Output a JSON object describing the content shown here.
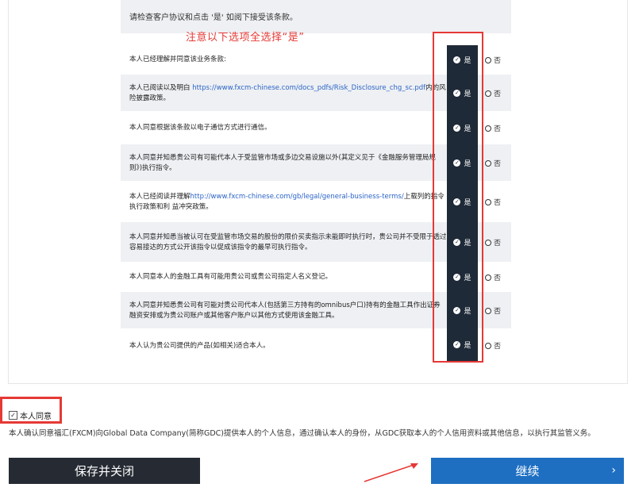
{
  "intro": {
    "text": "请检查客户协议和点击 '是' 如阅下接受该条款。"
  },
  "annotation": {
    "text": "注意以下选项全选择“是”"
  },
  "options": {
    "yes_label": "是",
    "no_label": "否"
  },
  "terms": [
    {
      "text": "本人已经理解并同意该业务条款:"
    },
    {
      "before": "本人已阅读以及明白 ",
      "link": "https://www.fxcm-chinese.com/docs_pdfs/Risk_Disclosure_chg_sc.pdf",
      "after": "内的风险披露政策。"
    },
    {
      "text": "本人同意根据该条款以电子通信方式进行通信。"
    },
    {
      "text": "本人同意并知悉贵公司有可能代本人于受监管市场或多边交易设施以外(其定义见于《金融服务管理局规则》)执行指令。"
    },
    {
      "before": "本人已经阅读并理解",
      "link": "http://www.fxcm-chinese.com/gb/legal/general-business-terms/",
      "after": "上载列的指令执行政策和利 益冲突政策。"
    },
    {
      "text": "本人同意并知悉当被认可在受监管市场交易的股份的限价买卖指示未能即时执行时，贵公司并不受限于透过容易接达的方式公开该指令以促成该指令的最早可执行指令。"
    },
    {
      "text": "本人同意本人的金融工具有可能用贵公司或贵公司指定人名义登记。"
    },
    {
      "text": "本人同意并知悉贵公司有可能对贵公司代本人(包括第三方持有的omnibus户口)持有的金融工具作出证券融资安排或为贵公司账户或其他客户账户以其他方式使用该金融工具。"
    },
    {
      "text": "本人认为贵公司提供的产品(如相关)适合本人。"
    }
  ],
  "agree": {
    "checked": true,
    "label": "本人同意",
    "note": "本人确认同意福汇(FXCM)向Global Data Company(简称GDC)提供本人的个人信息，通过确认本人的身份，从GDC获取本人的个人信用资料或其他信息，以执行其监管义务。"
  },
  "buttons": {
    "save": "保存并关闭",
    "continue": "继续"
  },
  "colors": {
    "annotation_red": "#e53935",
    "yes_button_bg": "#1f2a38",
    "save_button_bg": "#252a33",
    "continue_button_bg": "#1e6fc2",
    "link_blue": "#2b64c8"
  }
}
